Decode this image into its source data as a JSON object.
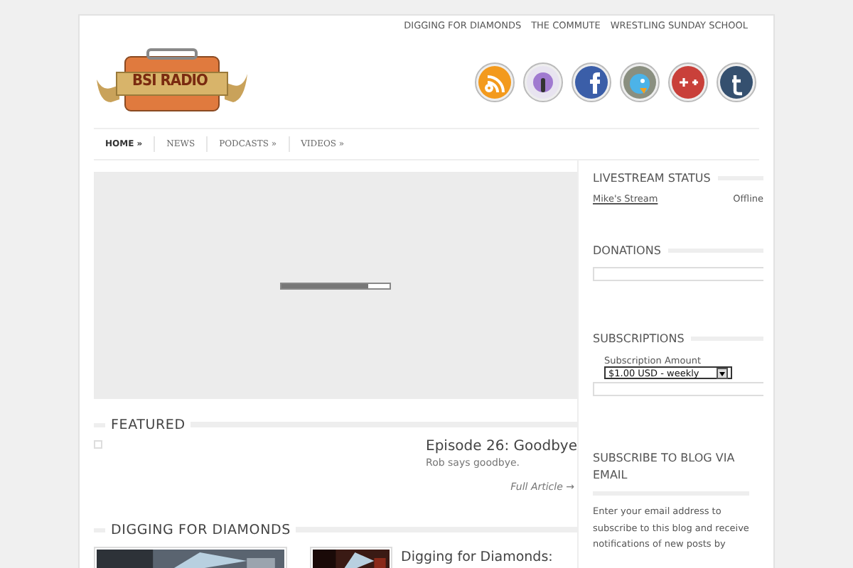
{
  "top_links": [
    "DIGGING FOR DIAMONDS",
    "THE COMMUTE",
    "WRESTLING SUNDAY SCHOOL"
  ],
  "logo": {
    "text": "BSI RADIO"
  },
  "social": [
    {
      "kind": "rss"
    },
    {
      "kind": "podcast"
    },
    {
      "kind": "facebook"
    },
    {
      "kind": "twitter"
    },
    {
      "kind": "googleplus"
    },
    {
      "kind": "tumblr"
    }
  ],
  "nav": [
    {
      "label": "HOME »",
      "selected": true
    },
    {
      "label": "NEWS",
      "selected": false
    },
    {
      "label": "PODCASTS »",
      "selected": false
    },
    {
      "label": "VIDEOS »",
      "selected": false
    }
  ],
  "player": {
    "level": 0.8
  },
  "featured": {
    "heading": "FEATURED",
    "title": "Episode 26: Goodbye",
    "summary": "Rob says goodbye.",
    "link": "Full Article →"
  },
  "digging": {
    "heading": "DIGGING FOR DIAMONDS",
    "post_title": "Digging for Diamonds:"
  },
  "sidebar": {
    "livestream": {
      "heading": "LIVESTREAM STATUS",
      "stream": "Mike's Stream",
      "status": "Offline"
    },
    "donations": {
      "heading": "DONATIONS"
    },
    "subscriptions": {
      "heading": "SUBSCRIPTIONS",
      "label": "Subscription Amount",
      "value": "$1.00 USD - weekly"
    },
    "email": {
      "heading": "SUBSCRIBE TO BLOG VIA EMAIL",
      "text": "Enter your email address to subscribe to this blog and receive notifications of new posts by"
    }
  }
}
